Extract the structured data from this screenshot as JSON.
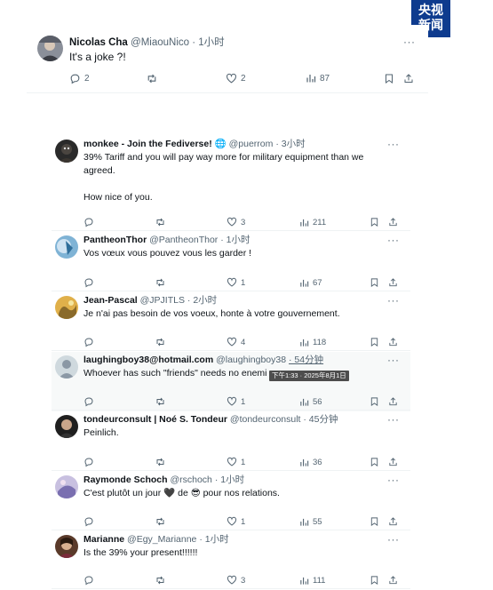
{
  "watermark": {
    "line1": "央视",
    "line2": "新闻"
  },
  "top_tweet": {
    "name": "Nicolas Cha",
    "handle": "@MiaouNico",
    "time": "· 1小时",
    "text": "It's a joke ?!",
    "replies": "2",
    "retweets": "",
    "likes": "2",
    "views": "87"
  },
  "replies": [
    {
      "name": "monkee - Join the Fediverse! 🌐",
      "handle": "@puerrom",
      "time": "· 3小时",
      "text": "39% Tariff and you will pay way more for military equipment than we agreed.\n\nHow nice of you.",
      "replies": "",
      "retweets": "",
      "likes": "3",
      "views": "211"
    },
    {
      "name": "PantheonThor",
      "handle": "@PantheonThor",
      "time": "· 1小时",
      "text": "Vos vœux vous pouvez vous les garder !",
      "replies": "",
      "retweets": "",
      "likes": "1",
      "views": "67"
    },
    {
      "name": "Jean-Pascal",
      "handle": "@JPJITLS",
      "time": "· 2小时",
      "text": "Je n'ai pas besoin de vos voeux, honte à votre gouvernement.",
      "replies": "",
      "retweets": "",
      "likes": "4",
      "views": "118"
    },
    {
      "name": "laughingboy38@hotmail.com",
      "handle": "@laughingboy38",
      "time": "· 54分钟",
      "text": "Whoever has such \"friends\" needs no enemi",
      "tooltip": "下午1:33 · 2025年8月1日",
      "replies": "",
      "retweets": "",
      "likes": "1",
      "views": "56"
    },
    {
      "name": "tondeurconsult | Noé S. Tondeur",
      "handle": "@tondeurconsult",
      "time": "· 45分钟",
      "text": "Peinlich.",
      "replies": "",
      "retweets": "",
      "likes": "1",
      "views": "36"
    },
    {
      "name": "Raymonde Schoch",
      "handle": "@rschoch",
      "time": "· 1小时",
      "text": "C'est plutôt un jour 🖤 de 😎 pour nos relations.",
      "replies": "",
      "retweets": "",
      "likes": "1",
      "views": "55"
    },
    {
      "name": "Marianne",
      "handle": "@Egy_Marianne",
      "time": "· 1小时",
      "text": "Is the 39% your present!!!!!!",
      "replies": "",
      "retweets": "",
      "likes": "3",
      "views": "111"
    }
  ],
  "colors": {
    "text": "#0f1419",
    "muted": "#536471",
    "hover_bg": "#f7f9f9",
    "logo_bg": "#0e3b8e"
  }
}
